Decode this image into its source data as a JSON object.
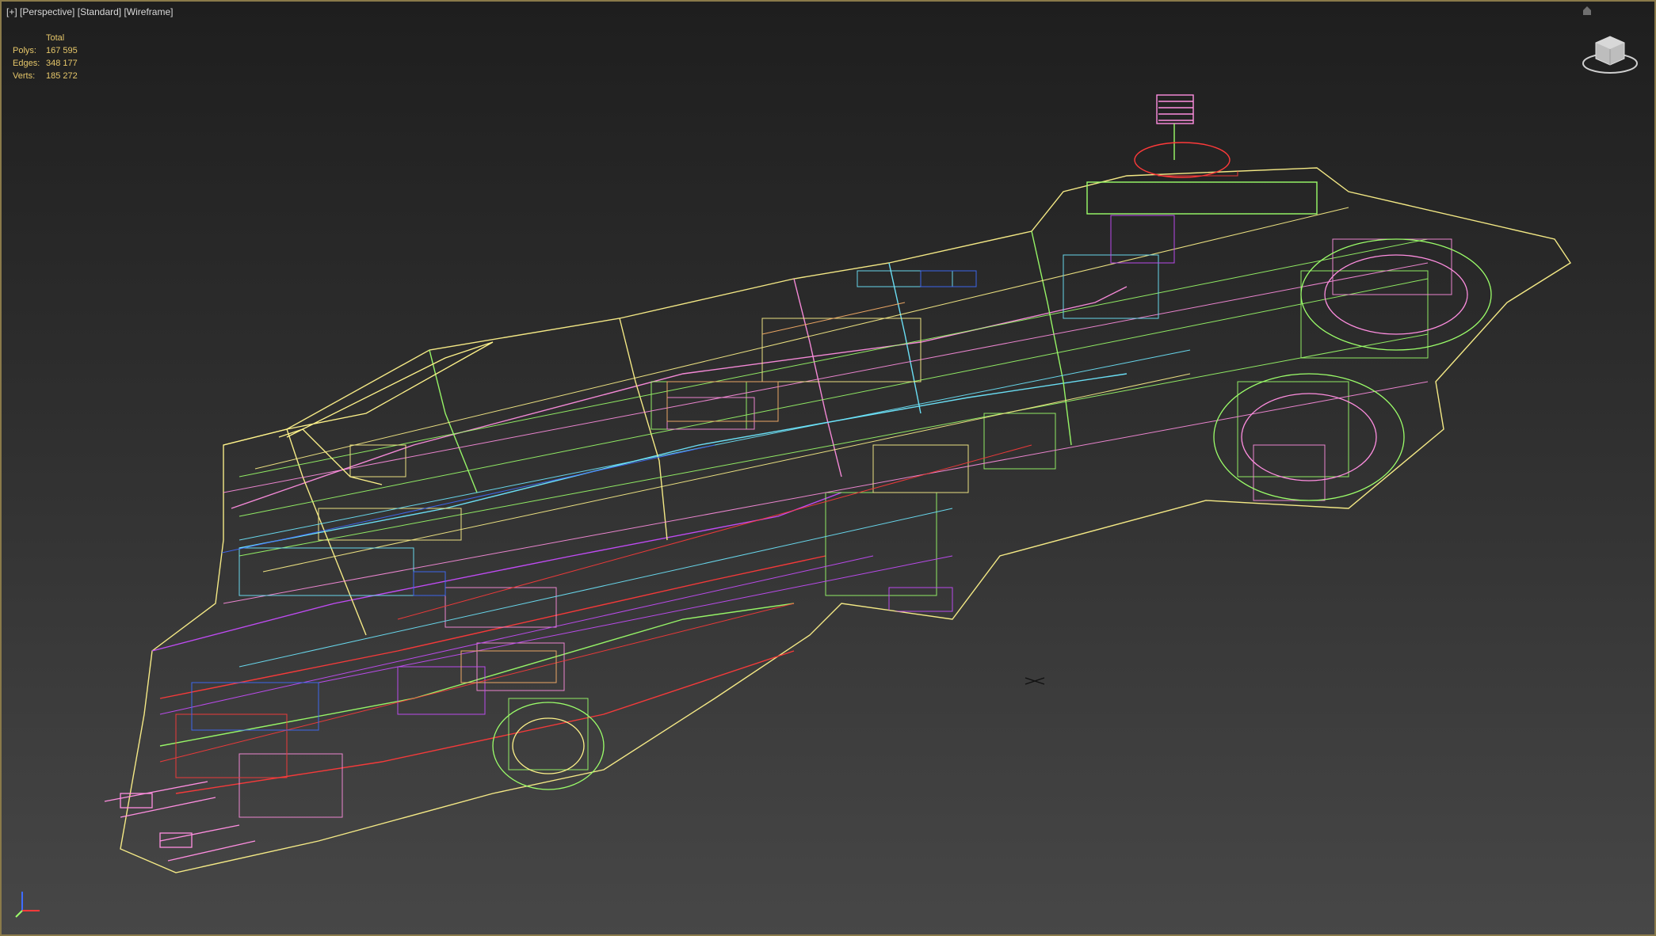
{
  "viewport": {
    "label_plus": "[+]",
    "label_view": "[Perspective]",
    "label_shading": "[Standard]",
    "label_mode": "[Wireframe]"
  },
  "stats": {
    "header": "Total",
    "polys_label": "Polys:",
    "polys_value": "167 595",
    "edges_label": "Edges:",
    "edges_value": "348 177",
    "verts_label": "Verts:",
    "verts_value": "185 272"
  },
  "colors": {
    "frame": "#8a7a4a",
    "stats_text": "#e6c76a",
    "wire_palette": [
      "#9cff6a",
      "#ff8ee0",
      "#fff38a",
      "#6ee8ff",
      "#c84dff",
      "#ff3a3a",
      "#3f6cff",
      "#ffb36a",
      "#7affc2"
    ]
  },
  "icons": {
    "viewcube": "viewcube-icon",
    "axis": "axis-tripod-icon",
    "pivot": "pivot-marker-icon"
  }
}
